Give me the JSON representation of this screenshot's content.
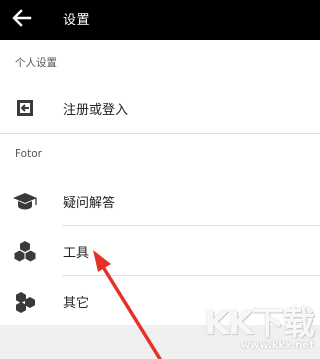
{
  "appbar": {
    "title": "设置",
    "back_icon": "arrow-left-icon"
  },
  "sections": {
    "personal": {
      "header": "个人设置",
      "items": [
        {
          "label": "注册或登入",
          "icon": "sign-in-icon"
        }
      ]
    },
    "fotor": {
      "header": "Fotor",
      "items": [
        {
          "label": "疑问解答",
          "icon": "graduation-cap-icon"
        },
        {
          "label": "工具",
          "icon": "cubes-icon"
        },
        {
          "label": "其它",
          "icon": "hexagons-icon"
        }
      ]
    }
  },
  "annotation": {
    "color": "#e8302a"
  },
  "watermark": {
    "logo": "KK下载",
    "url": "www.kkx.net"
  }
}
